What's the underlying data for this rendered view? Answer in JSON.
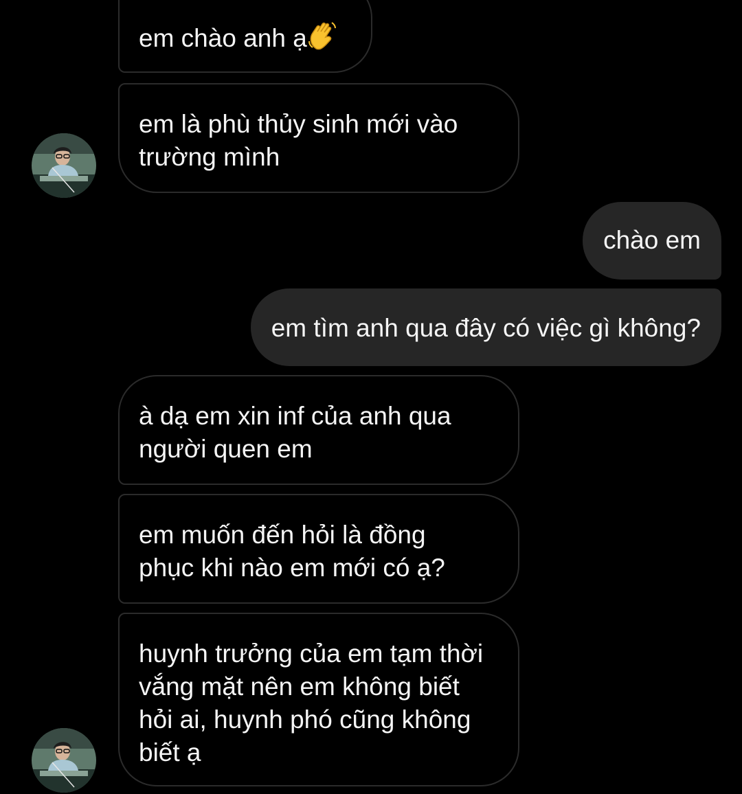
{
  "messages": [
    {
      "from": "them",
      "text": "em chào anh ạ",
      "emoji": "waving-hand"
    },
    {
      "from": "them",
      "text": "em là phù thủy sinh mới vào trường mình"
    },
    {
      "from": "me",
      "text": "chào em"
    },
    {
      "from": "me",
      "text": "em tìm anh qua đây có việc gì không?"
    },
    {
      "from": "them",
      "text": "à dạ em xin inf của anh qua người quen em"
    },
    {
      "from": "them",
      "text": "em muốn đến hỏi là đồng phục khi nào em mới có ạ?"
    },
    {
      "from": "them",
      "text": "huynh trưởng của em tạm thời vắng mặt nên em không biết hỏi ai, huynh phó cũng không biết ạ"
    }
  ],
  "colors": {
    "background": "#000000",
    "outgoing_bubble": "#262626",
    "incoming_border": "#2b2b2b",
    "text": "#f5f5f5"
  }
}
